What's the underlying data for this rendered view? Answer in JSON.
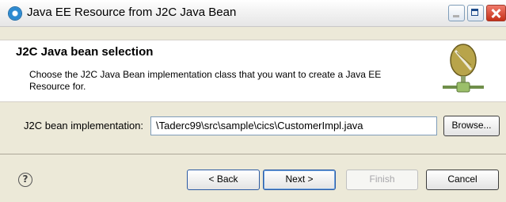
{
  "window": {
    "title": "Java EE Resource from J2C Java Bean",
    "icon": "circle-globe-icon"
  },
  "banner": {
    "title": "J2C Java bean selection",
    "description": "Choose the J2C Java Bean implementation class that you want to create a Java EE Resource for.",
    "icon": "coffee-bean-connector-icon"
  },
  "form": {
    "impl_label": "J2C bean implementation:",
    "impl_value": "\\Taderc99\\src\\sample\\cics\\CustomerImpl.java",
    "browse_label": "Browse..."
  },
  "footer": {
    "help_label": "?",
    "back_label": "< Back",
    "next_label": "Next >",
    "finish_label": "Finish",
    "cancel_label": "Cancel"
  },
  "colors": {
    "dialog_bg": "#ece9d8",
    "button_border_focus": "#2b5aa3",
    "close_button": "#c53018"
  }
}
